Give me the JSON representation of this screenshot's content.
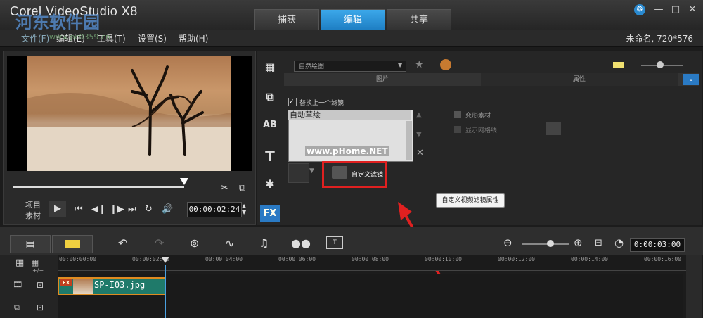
{
  "app": {
    "title": "Corel VideoStudio X8",
    "watermark": "河东软件园",
    "watermark_url": "www.pc0359.cn",
    "project_info": "未命名, 720*576"
  },
  "tabs": [
    {
      "label": "捕获"
    },
    {
      "label": "编辑"
    },
    {
      "label": "共享"
    }
  ],
  "menu": [
    {
      "label": "文件(F)"
    },
    {
      "label": "编辑(E)"
    },
    {
      "label": "工具(T)"
    },
    {
      "label": "设置(S)"
    },
    {
      "label": "帮助(H)"
    }
  ],
  "preview": {
    "mode_project": "项目",
    "mode_clip": "素材",
    "timecode": "00:00:02:24"
  },
  "filters": {
    "category": "自然绘图",
    "subtab_photo": "图片",
    "subtab_attributes": "属性",
    "replace_label": "替换上一个滤镜",
    "list": [
      {
        "name": "自动草绘"
      }
    ],
    "distort_label": "变形素材",
    "grid_label": "显示网格线",
    "custom_filter_label": "自定义滤镜",
    "tooltip": "自定义视频滤镜属性",
    "watermark2": "www.pHome.NET"
  },
  "timeline": {
    "timecode": "0:00:03:00",
    "ticks": [
      "00:00:00:00",
      "00:00:02:00",
      "00:00:04:00",
      "00:00:06:00",
      "00:00:08:00",
      "00:00:10:00",
      "00:00:12:00",
      "00:00:14:00",
      "00:00:16:00"
    ],
    "clip_name": "SP-I03.jpg",
    "clip_badge": "FX",
    "zoom_label": "+/−"
  },
  "colors": {
    "active_tab": "#2a90d8",
    "highlight_box": "#e02020",
    "clip_fill": "#1f7a6a",
    "clip_border": "#e08b20"
  }
}
